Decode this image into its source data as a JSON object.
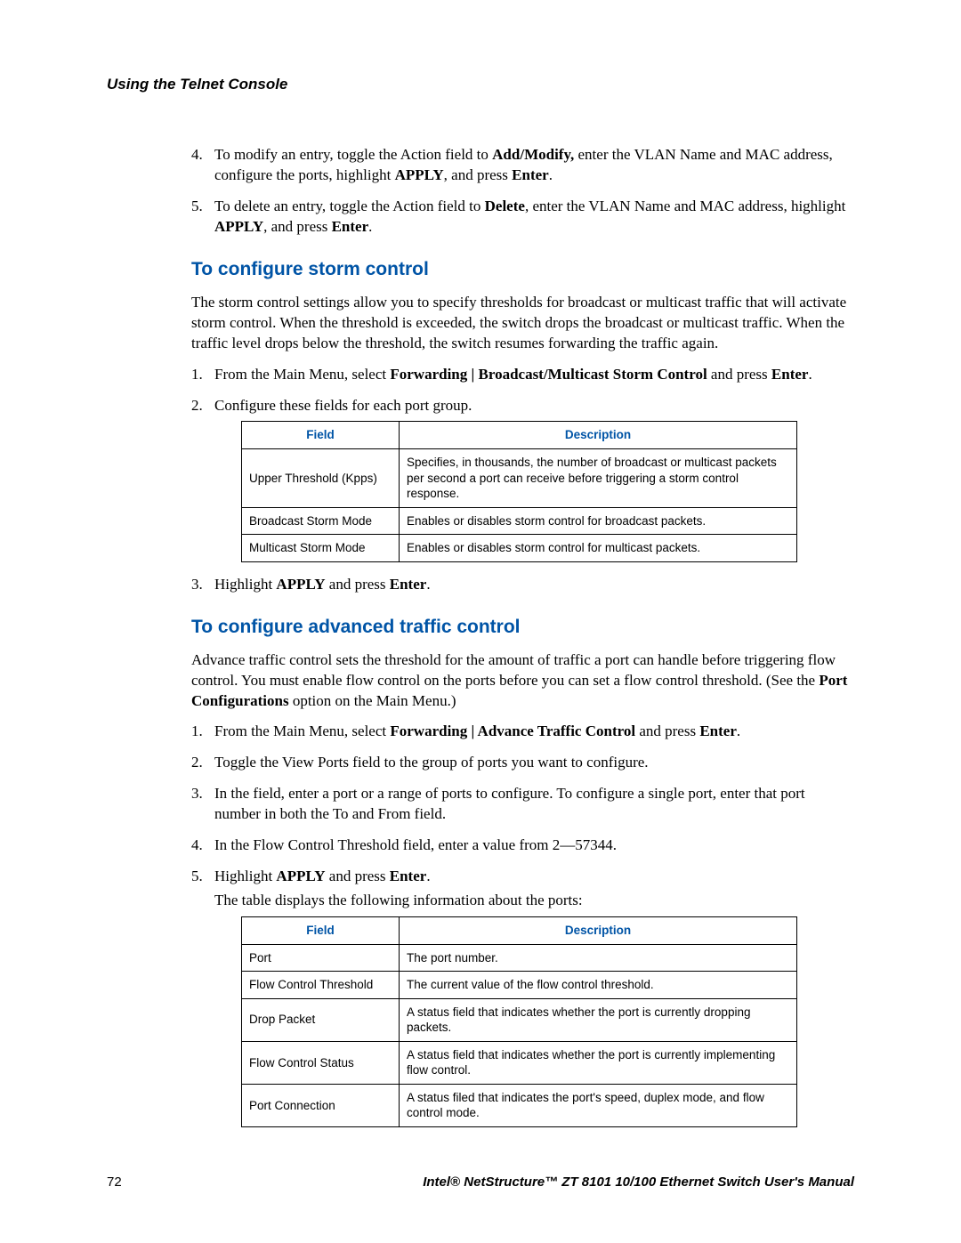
{
  "runningHead": "Using the Telnet Console",
  "introList": {
    "items": [
      {
        "n": "4.",
        "pre": "To modify an entry, toggle the Action field to ",
        "b1": "Add/Modify,",
        "mid1": " enter the VLAN Name and MAC address, configure the ports, highlight ",
        "b2": "APPLY",
        "mid2": ", and press ",
        "b3": "Enter",
        "post": "."
      },
      {
        "n": "5.",
        "pre": "To delete an entry, toggle the Action field to ",
        "b1": "Delete",
        "mid1": ", enter the VLAN Name and MAC address, highlight ",
        "b2": "APPLY",
        "mid2": ", and press ",
        "b3": "Enter",
        "post": "."
      }
    ]
  },
  "storm": {
    "heading": "To configure storm control",
    "para": "The storm control settings allow you to specify thresholds for broadcast or multicast traffic that will activate storm control. When the threshold is exceeded, the switch drops the broadcast or multicast traffic. When the traffic level drops below the threshold, the switch resumes forwarding the traffic again.",
    "steps": [
      {
        "n": "1.",
        "pre": "From the Main Menu, select ",
        "b1": "Forwarding | Broadcast/Multicast Storm Control",
        "mid1": " and press ",
        "b2": "Enter",
        "post": "."
      },
      {
        "n": "2.",
        "plain": "Configure these fields for each port group."
      },
      {
        "n": "3.",
        "pre": "Highlight ",
        "b1": "APPLY",
        "mid1": " and press ",
        "b2": "Enter",
        "post": "."
      }
    ],
    "table": {
      "h1": "Field",
      "h2": "Description",
      "rows": [
        {
          "f": "Upper Threshold (Kpps)",
          "d": "Specifies, in thousands, the number of broadcast or multicast packets per second a port can receive before triggering a storm control response."
        },
        {
          "f": "Broadcast Storm Mode",
          "d": "Enables or disables storm control for broadcast packets."
        },
        {
          "f": "Multicast Storm Mode",
          "d": "Enables or disables storm control for multicast packets."
        }
      ]
    }
  },
  "adv": {
    "heading": "To configure advanced traffic control",
    "paraPre": "Advance traffic control sets the threshold for the amount of traffic a port can handle before triggering flow control. You must enable flow control on the ports before you can set a flow control threshold. (See the ",
    "paraBold": "Port Configurations",
    "paraPost": " option on the Main Menu.)",
    "steps": [
      {
        "n": "1.",
        "pre": "From the Main Menu, select ",
        "b1": "Forwarding | Advance Traffic Control",
        "mid1": " and press ",
        "b2": "Enter",
        "post": "."
      },
      {
        "n": "2.",
        "plain": "Toggle the View Ports field to the group of ports you want to configure."
      },
      {
        "n": "3.",
        "plain": "In the field, enter a port or a range of ports to configure. To configure a single port, enter that port number in both the To and From field."
      },
      {
        "n": "4.",
        "plain": "In the Flow Control Threshold field, enter a value from 2—57344."
      },
      {
        "n": "5.",
        "pre": "Highlight ",
        "b1": "APPLY",
        "mid1": " and press ",
        "b2": "Enter",
        "post": ".",
        "after": "The table displays the following information about the ports:"
      }
    ],
    "table": {
      "h1": "Field",
      "h2": "Description",
      "rows": [
        {
          "f": "Port",
          "d": "The port number."
        },
        {
          "f": "Flow Control Threshold",
          "d": "The current value of the flow control threshold."
        },
        {
          "f": "Drop Packet",
          "d": "A status field that indicates whether the port is currently dropping packets."
        },
        {
          "f": "Flow Control Status",
          "d": "A status field that indicates whether the port is currently implementing flow control."
        },
        {
          "f": "Port Connection",
          "d": "A status filed that indicates the port's speed, duplex mode, and flow control mode."
        }
      ]
    }
  },
  "footer": {
    "page": "72",
    "title": "Intel® NetStructure™ ZT 8101 10/100 Ethernet Switch User's Manual"
  }
}
